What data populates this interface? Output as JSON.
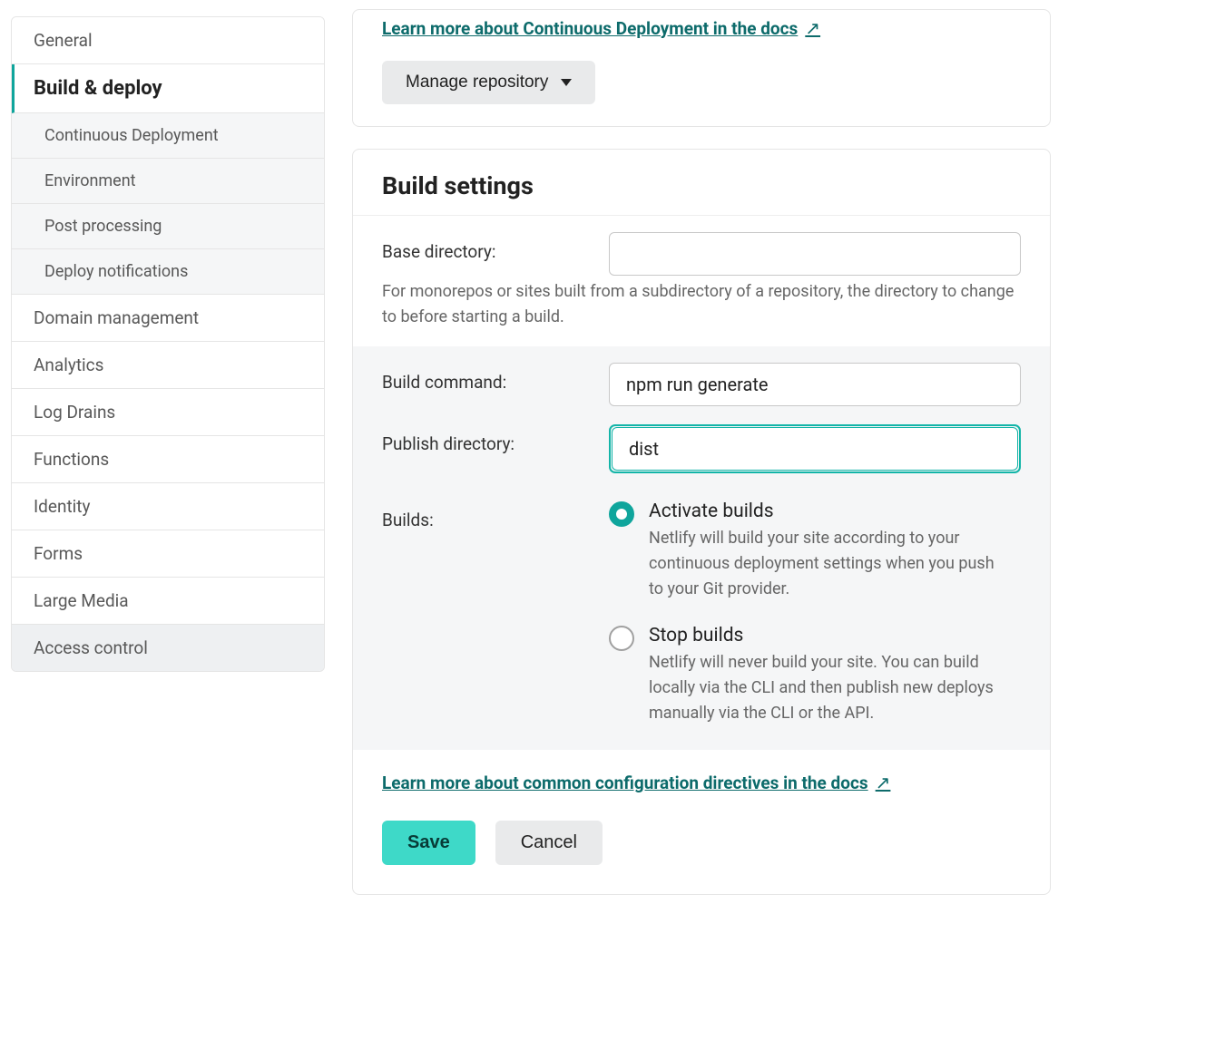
{
  "sidebar": {
    "items": [
      {
        "label": "General"
      },
      {
        "label": "Build & deploy"
      },
      {
        "label": "Domain management"
      },
      {
        "label": "Analytics"
      },
      {
        "label": "Log Drains"
      },
      {
        "label": "Functions"
      },
      {
        "label": "Identity"
      },
      {
        "label": "Forms"
      },
      {
        "label": "Large Media"
      },
      {
        "label": "Access control"
      }
    ],
    "sub_items": [
      {
        "label": "Continuous Deployment"
      },
      {
        "label": "Environment"
      },
      {
        "label": "Post processing"
      },
      {
        "label": "Deploy notifications"
      }
    ]
  },
  "top_card": {
    "learn_link": "Learn more about Continuous Deployment in the docs",
    "manage_repo": "Manage repository"
  },
  "build": {
    "title": "Build settings",
    "base_label": "Base directory:",
    "base_value": "",
    "base_help": "For monorepos or sites built from a subdirectory of a repository, the directory to change to before starting a build.",
    "cmd_label": "Build command:",
    "cmd_value": "npm run generate",
    "pub_label": "Publish directory:",
    "pub_value": "dist",
    "builds_label": "Builds:",
    "radios": [
      {
        "title": "Activate builds",
        "desc": "Netlify will build your site according to your continuous deployment settings when you push to your Git provider."
      },
      {
        "title": "Stop builds",
        "desc": "Netlify will never build your site. You can build locally via the CLI and then publish new deploys manually via the CLI or the API."
      }
    ],
    "learn_link": "Learn more about common configuration directives in the docs",
    "save": "Save",
    "cancel": "Cancel"
  }
}
